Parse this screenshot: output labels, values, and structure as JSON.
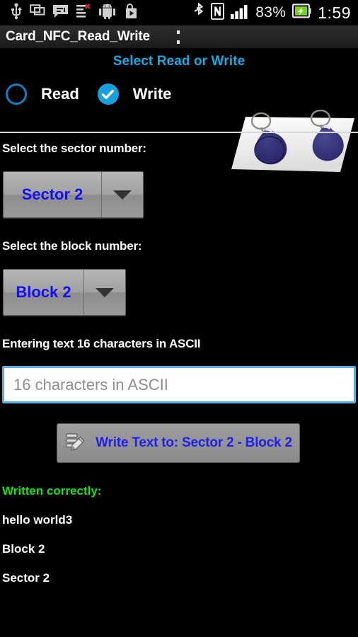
{
  "statusbar": {
    "icons_left": [
      "usb-icon",
      "screen-cast-icon",
      "sms-message-icon",
      "task-list-error-icon",
      "android-robot-icon",
      "play-store-icon"
    ],
    "icons_right": [
      "bluetooth-icon",
      "nfc-icon",
      "signal-bars-icon",
      "battery-charging-icon"
    ],
    "battery_percent": "83%",
    "time": "1:59"
  },
  "titlebar": {
    "app_title": "Card_NFC_Read_Write",
    "overflow_icon": "overflow-menu-icon"
  },
  "mode_section": {
    "heading": "Select Read or Write",
    "options": [
      {
        "label": "Read",
        "selected": false
      },
      {
        "label": "Write",
        "selected": true
      }
    ],
    "photo_alt": "nfc-keyfob-tags-photo"
  },
  "sector": {
    "label": "Select the sector number:",
    "selected": "Sector 2",
    "dropdown_icon": "chevron-down-icon"
  },
  "block": {
    "label": "Select the block number:",
    "selected": "Block 2",
    "dropdown_icon": "chevron-down-icon"
  },
  "input": {
    "label": "Entering text 16 characters in ASCII",
    "placeholder": "16 characters in ASCII",
    "value": ""
  },
  "write_button": {
    "icon": "edit-write-icon",
    "label": "Write Text to: Sector 2 - Block 2"
  },
  "result": {
    "status": "Written correctly:",
    "lines": [
      "hello world3",
      "Block 2",
      "Sector 2"
    ]
  },
  "colors": {
    "accent_cyan": "#1CA9E0",
    "spinner_text_blue": "#1510F0",
    "success_green": "#19E019",
    "field_border_blue": "#55AEE2",
    "background": "#000000"
  }
}
